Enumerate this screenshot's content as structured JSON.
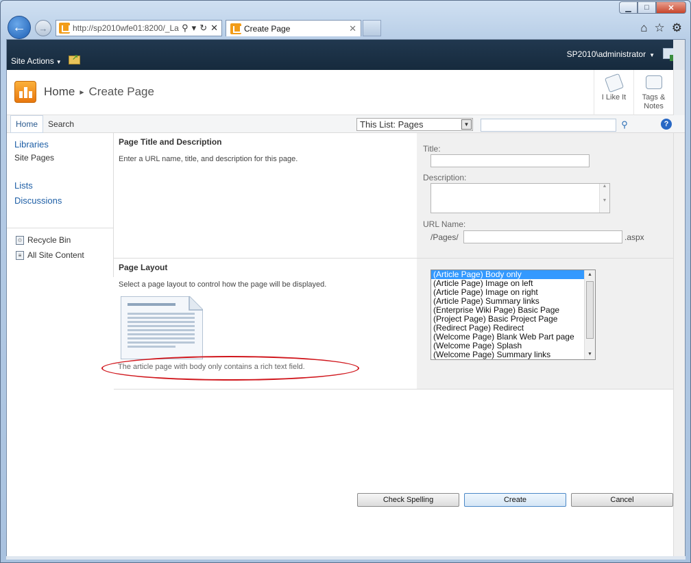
{
  "browser": {
    "address": "http://sp2010wfe01:8200/_La",
    "address_host": "sp2010wfe01",
    "tab_title": "Create Page"
  },
  "ribbon": {
    "site_actions": "Site Actions",
    "user": "SP2010\\administrator"
  },
  "header": {
    "home": "Home",
    "current": "Create Page",
    "i_like_it": "I Like It",
    "tags_notes": "Tags &",
    "tags_notes_2": "Notes"
  },
  "topnav": {
    "items": [
      "Home",
      "Search"
    ],
    "scope": "This List: Pages"
  },
  "quicklaunch": {
    "libraries": "Libraries",
    "site_pages": "Site Pages",
    "lists": "Lists",
    "discussions": "Discussions",
    "recycle_bin": "Recycle Bin",
    "all_site_content": "All Site Content"
  },
  "form": {
    "section1_title": "Page Title and Description",
    "section1_desc": "Enter a URL name, title, and description for this page.",
    "title_label": "Title:",
    "description_label": "Description:",
    "url_label": "URL Name:",
    "url_prefix": "/Pages/",
    "url_suffix": ".aspx",
    "section2_title": "Page Layout",
    "section2_desc": "Select a page layout to control how the page will be displayed.",
    "layout_description": "The article page with body only contains a rich text field.",
    "layouts": [
      "(Article Page) Body only",
      "(Article Page) Image on left",
      "(Article Page) Image on right",
      "(Article Page) Summary links",
      "(Enterprise Wiki Page) Basic Page",
      "(Project Page) Basic Project Page",
      "(Redirect Page) Redirect",
      "(Welcome Page) Blank Web Part page",
      "(Welcome Page) Splash",
      "(Welcome Page) Summary links"
    ]
  },
  "buttons": {
    "check_spelling": "Check Spelling",
    "create": "Create",
    "cancel": "Cancel"
  },
  "colors": {
    "ribbon_bg": "#21384f",
    "selected_option": "#3399ff",
    "annotation": "#d0161c"
  }
}
